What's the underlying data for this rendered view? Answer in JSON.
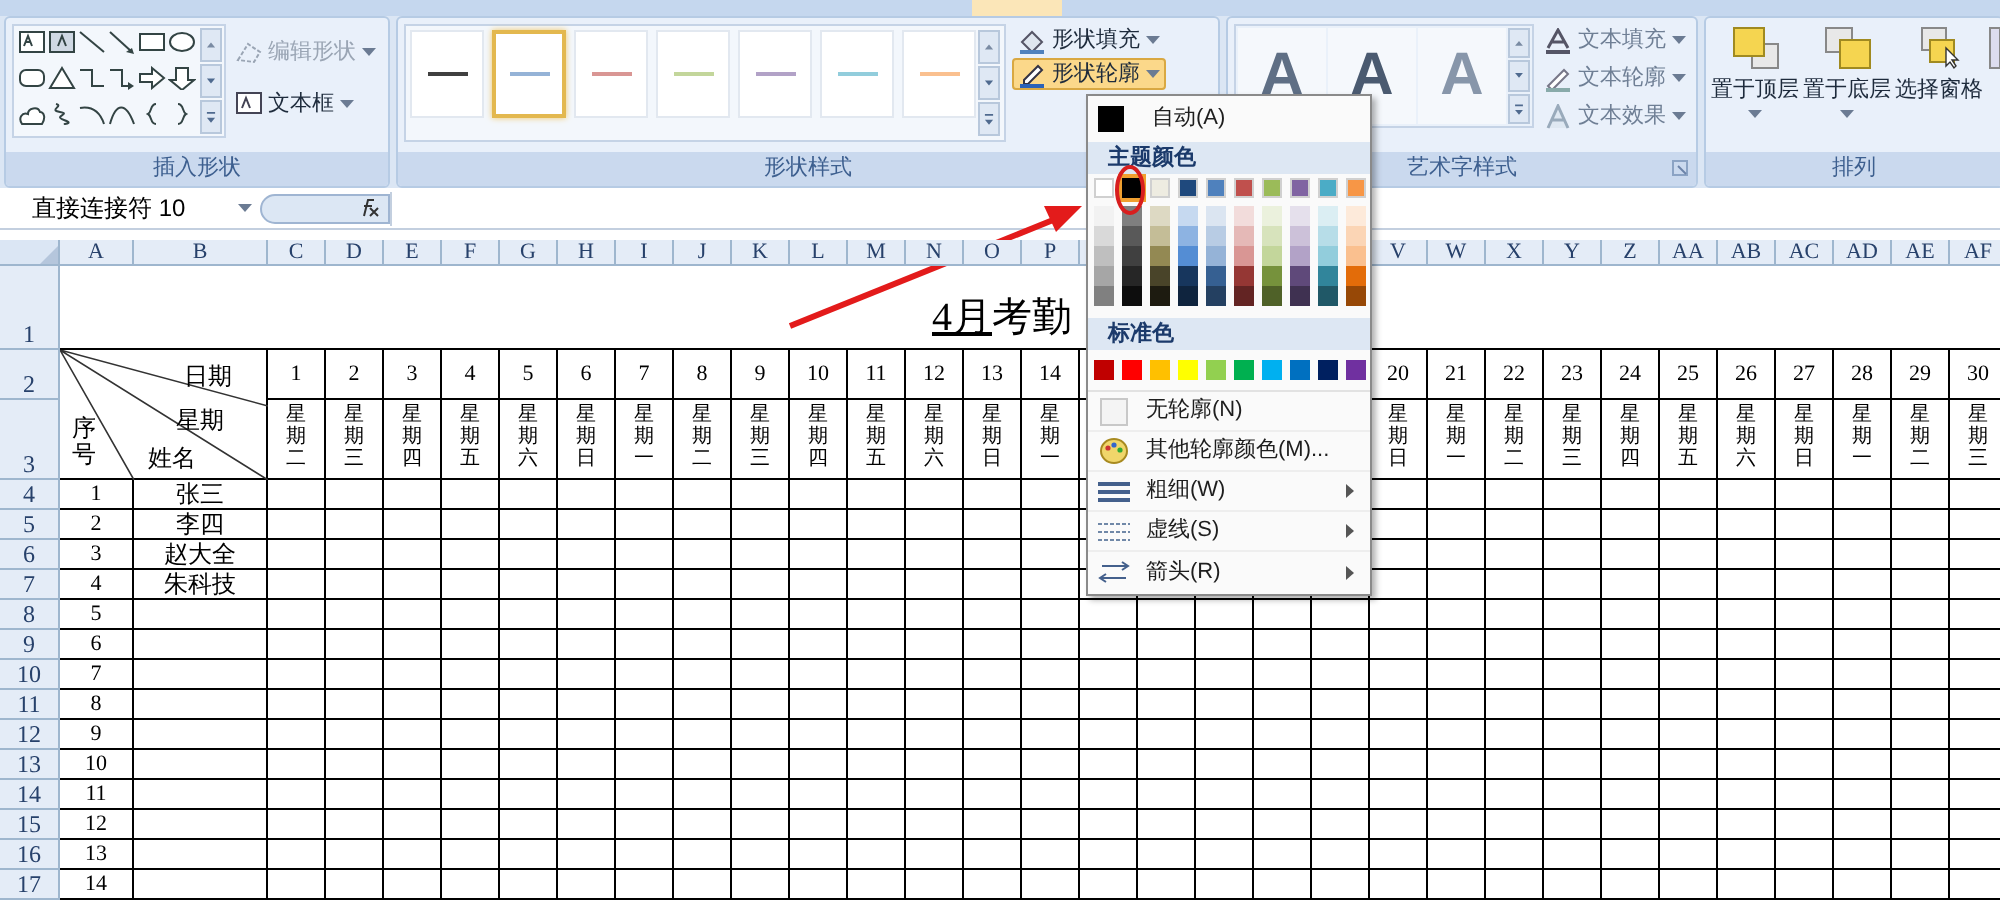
{
  "insert_shapes": {
    "label": "插入形状",
    "edit_shape": {
      "label": "编辑形状",
      "disabled": true
    },
    "text_box": {
      "label": "文本框",
      "disabled": false
    }
  },
  "shape_styles": {
    "label": "形状样式",
    "styles": [
      {
        "color": "#404040",
        "selected": false
      },
      {
        "color": "#95b3d7",
        "selected": true
      },
      {
        "color": "#d99694",
        "selected": false
      },
      {
        "color": "#c3d69b",
        "selected": false
      },
      {
        "color": "#b2a2c7",
        "selected": false
      },
      {
        "color": "#92cddc",
        "selected": false
      },
      {
        "color": "#fac08f",
        "selected": false
      }
    ],
    "fill": {
      "label": "形状填充",
      "expanded": false
    },
    "outline": {
      "label": "形状轮廓",
      "expanded": true
    }
  },
  "wordart_styles": {
    "label": "艺术字样式",
    "presets": [
      {
        "label": "A",
        "kind": "outlined"
      },
      {
        "label": "A",
        "kind": "bold"
      },
      {
        "label": "A",
        "kind": "light"
      }
    ],
    "buttons": [
      {
        "label": "文本填充"
      },
      {
        "label": "文本轮廓"
      },
      {
        "label": "文本效果"
      }
    ]
  },
  "arrange": {
    "label": "排列",
    "buttons": [
      {
        "label": "置于顶层",
        "dropdown": true
      },
      {
        "label": "置于底层",
        "dropdown": true
      },
      {
        "label": "选择窗格",
        "dropdown": false
      }
    ]
  },
  "formula_bar": {
    "name_box": "直接连接符 10"
  },
  "sheet": {
    "columns": [
      "A",
      "B",
      "C",
      "D",
      "E",
      "F",
      "G",
      "H",
      "I",
      "J",
      "K",
      "L",
      "M",
      "N",
      "O",
      "P",
      "V",
      "W",
      "X",
      "Y",
      "Z",
      "AA",
      "AB",
      "AC",
      "AD",
      "AE",
      "AF"
    ],
    "row_numbers": [
      "1",
      "2",
      "3",
      "4",
      "5",
      "6",
      "7",
      "8",
      "9",
      "10",
      "11",
      "12",
      "13",
      "14",
      "15",
      "16",
      "17"
    ],
    "title_underlined": "4月",
    "title": "考勤",
    "header": {
      "date_label": "日期",
      "weekday_label": "星期",
      "seq_label": "序号",
      "name_label": "姓名"
    },
    "days": [
      {
        "day": "1",
        "weekday": "星期二"
      },
      {
        "day": "2",
        "weekday": "星期三"
      },
      {
        "day": "3",
        "weekday": "星期四"
      },
      {
        "day": "4",
        "weekday": "星期五"
      },
      {
        "day": "5",
        "weekday": "星期六"
      },
      {
        "day": "6",
        "weekday": "星期日"
      },
      {
        "day": "7",
        "weekday": "星期一"
      },
      {
        "day": "8",
        "weekday": "星期二"
      },
      {
        "day": "9",
        "weekday": "星期三"
      },
      {
        "day": "10",
        "weekday": "星期四"
      },
      {
        "day": "11",
        "weekday": "星期五"
      },
      {
        "day": "12",
        "weekday": "星期六"
      },
      {
        "day": "13",
        "weekday": "星期日"
      },
      {
        "day": "14",
        "weekday": "星期一"
      },
      {
        "day": "20",
        "weekday": "星期日"
      },
      {
        "day": "21",
        "weekday": "星期一"
      },
      {
        "day": "22",
        "weekday": "星期二"
      },
      {
        "day": "23",
        "weekday": "星期三"
      },
      {
        "day": "24",
        "weekday": "星期四"
      },
      {
        "day": "25",
        "weekday": "星期五"
      },
      {
        "day": "26",
        "weekday": "星期六"
      },
      {
        "day": "27",
        "weekday": "星期日"
      },
      {
        "day": "28",
        "weekday": "星期一"
      },
      {
        "day": "29",
        "weekday": "星期二"
      },
      {
        "day": "30",
        "weekday": "星期三"
      }
    ],
    "records": [
      {
        "seq": "1",
        "name": "张三"
      },
      {
        "seq": "2",
        "name": "李四"
      },
      {
        "seq": "3",
        "name": "赵大全"
      },
      {
        "seq": "4",
        "name": "朱科技"
      },
      {
        "seq": "5"
      },
      {
        "seq": "6"
      },
      {
        "seq": "7"
      },
      {
        "seq": "8"
      },
      {
        "seq": "9"
      },
      {
        "seq": "10"
      },
      {
        "seq": "11"
      },
      {
        "seq": "12"
      },
      {
        "seq": "13"
      },
      {
        "seq": "14"
      }
    ]
  },
  "outline_menu": {
    "automatic": {
      "label": "自动(A)",
      "color": "#000000"
    },
    "theme_header": "主题颜色",
    "theme_colors": [
      {
        "color": "#ffffff",
        "selected": false,
        "shades": [
          {
            "color": "#f2f2f2"
          },
          {
            "color": "#d9d9d9"
          },
          {
            "color": "#bfbfbf"
          },
          {
            "color": "#a6a6a6"
          },
          {
            "color": "#808080"
          }
        ]
      },
      {
        "color": "#000000",
        "selected": true,
        "shades": [
          {
            "color": "#7f7f7f"
          },
          {
            "color": "#595959"
          },
          {
            "color": "#404040"
          },
          {
            "color": "#262626"
          },
          {
            "color": "#0d0d0d"
          }
        ]
      },
      {
        "color": "#eeece1",
        "selected": false,
        "shades": [
          {
            "color": "#ddd9c3"
          },
          {
            "color": "#c4bd97"
          },
          {
            "color": "#938953"
          },
          {
            "color": "#494429"
          },
          {
            "color": "#1d1b10"
          }
        ]
      },
      {
        "color": "#1f497d",
        "selected": false,
        "shades": [
          {
            "color": "#c6d9f0"
          },
          {
            "color": "#8db3e2"
          },
          {
            "color": "#548dd4"
          },
          {
            "color": "#17365d"
          },
          {
            "color": "#0f243e"
          }
        ]
      },
      {
        "color": "#4f81bd",
        "selected": false,
        "shades": [
          {
            "color": "#dbe5f1"
          },
          {
            "color": "#b8cce4"
          },
          {
            "color": "#95b3d7"
          },
          {
            "color": "#366092"
          },
          {
            "color": "#244061"
          }
        ]
      },
      {
        "color": "#c0504d",
        "selected": false,
        "shades": [
          {
            "color": "#f2dcdb"
          },
          {
            "color": "#e5b9b7"
          },
          {
            "color": "#d99694"
          },
          {
            "color": "#953734"
          },
          {
            "color": "#632423"
          }
        ]
      },
      {
        "color": "#9bbb59",
        "selected": false,
        "shades": [
          {
            "color": "#ebf1dd"
          },
          {
            "color": "#d7e3bc"
          },
          {
            "color": "#c3d69b"
          },
          {
            "color": "#76923c"
          },
          {
            "color": "#4f6128"
          }
        ]
      },
      {
        "color": "#8064a2",
        "selected": false,
        "shades": [
          {
            "color": "#e5e0ec"
          },
          {
            "color": "#ccc1d9"
          },
          {
            "color": "#b2a2c7"
          },
          {
            "color": "#5f497a"
          },
          {
            "color": "#3f3151"
          }
        ]
      },
      {
        "color": "#4bacc6",
        "selected": false,
        "shades": [
          {
            "color": "#dbeef3"
          },
          {
            "color": "#b7dde8"
          },
          {
            "color": "#92cddc"
          },
          {
            "color": "#31859b"
          },
          {
            "color": "#205867"
          }
        ]
      },
      {
        "color": "#f79646",
        "selected": false,
        "shades": [
          {
            "color": "#fdeada"
          },
          {
            "color": "#fbd5b5"
          },
          {
            "color": "#fac08f"
          },
          {
            "color": "#e36c09"
          },
          {
            "color": "#974806"
          }
        ]
      }
    ],
    "standard_header": "标准色",
    "standard_colors": [
      {
        "color": "#c00000"
      },
      {
        "color": "#ff0000"
      },
      {
        "color": "#ffc000"
      },
      {
        "color": "#ffff00"
      },
      {
        "color": "#92d050"
      },
      {
        "color": "#00b050"
      },
      {
        "color": "#00b0f0"
      },
      {
        "color": "#0070c0"
      },
      {
        "color": "#002060"
      },
      {
        "color": "#7030a0"
      }
    ],
    "items": [
      {
        "label": "无轮廓(N)",
        "kind": "no_outline",
        "submenu": false
      },
      {
        "label": "其他轮廓颜色(M)...",
        "kind": "more_colors",
        "submenu": false
      },
      {
        "label": "粗细(W)",
        "kind": "weight",
        "submenu": true
      },
      {
        "label": "虚线(S)",
        "kind": "dashes",
        "submenu": true
      },
      {
        "label": "箭头(R)",
        "kind": "arrows",
        "submenu": true
      }
    ]
  }
}
